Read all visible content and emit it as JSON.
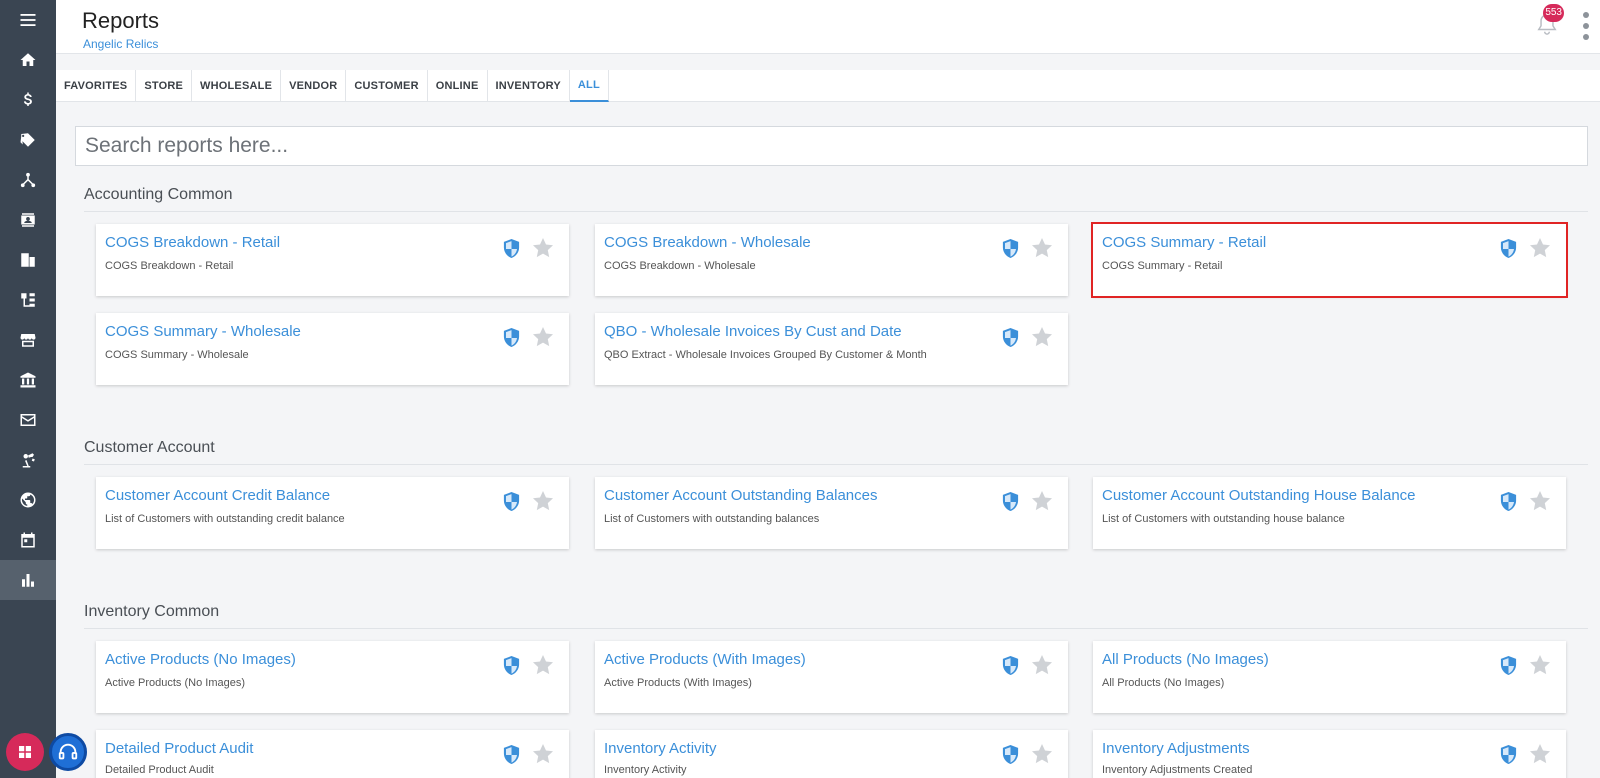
{
  "header": {
    "title": "Reports",
    "subtitle": "Angelic Relics",
    "notification_count": "553"
  },
  "tabs": [
    {
      "label": "FAVORITES"
    },
    {
      "label": "STORE"
    },
    {
      "label": "WHOLESALE"
    },
    {
      "label": "VENDOR"
    },
    {
      "label": "CUSTOMER"
    },
    {
      "label": "ONLINE"
    },
    {
      "label": "INVENTORY"
    },
    {
      "label": "ALL",
      "active": true
    }
  ],
  "search": {
    "placeholder": "Search reports here...",
    "value": ""
  },
  "sidebar": {
    "icons": [
      "menu-icon",
      "home-icon",
      "dollar-icon",
      "tags-icon",
      "network-icon",
      "contact-card-icon",
      "building-icon",
      "sitemap-icon",
      "store-icon",
      "bank-icon",
      "mail-icon",
      "robot-arm-icon",
      "globe-icon",
      "calendar-icon",
      "bar-chart-icon"
    ]
  },
  "sections": [
    {
      "title": "Accounting Common",
      "cards": [
        {
          "title": "COGS Breakdown - Retail",
          "desc": "COGS Breakdown - Retail"
        },
        {
          "title": "COGS Breakdown - Wholesale",
          "desc": "COGS Breakdown - Wholesale"
        },
        {
          "title": "COGS Summary - Retail",
          "desc": "COGS Summary - Retail"
        },
        {
          "title": "COGS Summary - Wholesale",
          "desc": "COGS Summary - Wholesale"
        },
        {
          "title": "QBO - Wholesale Invoices By Cust and Date",
          "desc": "QBO Extract - Wholesale Invoices Grouped By Customer & Month"
        }
      ]
    },
    {
      "title": "Customer Account",
      "cards": [
        {
          "title": "Customer Account Credit Balance",
          "desc": "List of Customers with outstanding credit balance"
        },
        {
          "title": "Customer Account Outstanding Balances",
          "desc": "List of Customers with outstanding balances"
        },
        {
          "title": "Customer Account Outstanding House Balance",
          "desc": "List of Customers with outstanding house balance"
        }
      ]
    },
    {
      "title": "Inventory Common",
      "cards": [
        {
          "title": "Active Products (No Images)",
          "desc": "Active Products (No Images)"
        },
        {
          "title": "Active Products (With Images)",
          "desc": "Active Products (With Images)"
        },
        {
          "title": "All Products (No Images)",
          "desc": "All Products (No Images)"
        },
        {
          "title": "Detailed Product Audit",
          "desc": "Detailed Product Audit"
        },
        {
          "title": "Inventory Activity",
          "desc": "Inventory Activity"
        },
        {
          "title": "Inventory Adjustments",
          "desc": "Inventory Adjustments Created"
        }
      ]
    }
  ],
  "colors": {
    "accent": "#3b8fd9",
    "sidebar": "#3a4552",
    "badge": "#d62a5a",
    "highlight": "#e02424"
  }
}
